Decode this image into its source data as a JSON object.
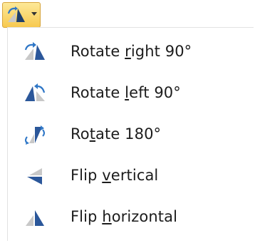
{
  "toolbar": {
    "rotate_button_icon": "rotate-icon",
    "dropdown_icon": "chevron-down-icon",
    "button_bg": "#f7c94f"
  },
  "menu": {
    "items": [
      {
        "before": "Rotate ",
        "accel": "r",
        "after": "ight 90°",
        "icon": "rotate-right-icon"
      },
      {
        "before": "Rotate ",
        "accel": "l",
        "after": "eft 90°",
        "icon": "rotate-left-icon"
      },
      {
        "before": "Ro",
        "accel": "t",
        "after": "ate 180°",
        "icon": "rotate-180-icon"
      },
      {
        "before": "Flip ",
        "accel": "v",
        "after": "ertical",
        "icon": "flip-vertical-icon"
      },
      {
        "before": "Flip ",
        "accel": "h",
        "after": "orizontal",
        "icon": "flip-horizontal-icon"
      }
    ]
  },
  "colors": {
    "icon_dark": "#2b579a",
    "icon_light": "#c8c8c8",
    "arrow_blue": "#2f77c7",
    "text": "#1c1c1c"
  }
}
